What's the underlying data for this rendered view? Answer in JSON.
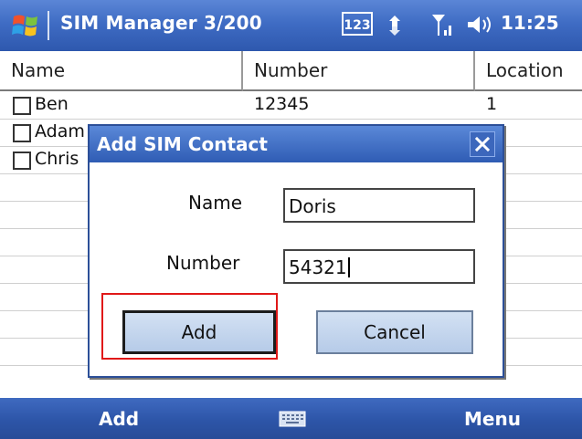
{
  "titlebar": {
    "title": "SIM Manager 3/200",
    "input_indicator": "123",
    "time": "11:25"
  },
  "list": {
    "columns": [
      "Name",
      "Number",
      "Location"
    ],
    "rows": [
      {
        "name": "Ben",
        "number": "12345",
        "location": "1"
      },
      {
        "name": "Adam",
        "number": "",
        "location": ""
      },
      {
        "name": "Chris",
        "number": "",
        "location": ""
      }
    ]
  },
  "dialog": {
    "title": "Add SIM Contact",
    "name_label": "Name",
    "name_value": "Doris",
    "number_label": "Number",
    "number_value": "54321",
    "add_label": "Add",
    "cancel_label": "Cancel"
  },
  "softkeys": {
    "left": "Add",
    "right": "Menu"
  },
  "colors": {
    "titlebar": "#3f6cc4",
    "highlight": "#e01818",
    "button": "#c3d5ee"
  },
  "icons": [
    "windows-start-icon",
    "connectivity-icon",
    "signal-icon",
    "volume-icon",
    "close-icon",
    "keyboard-icon"
  ]
}
